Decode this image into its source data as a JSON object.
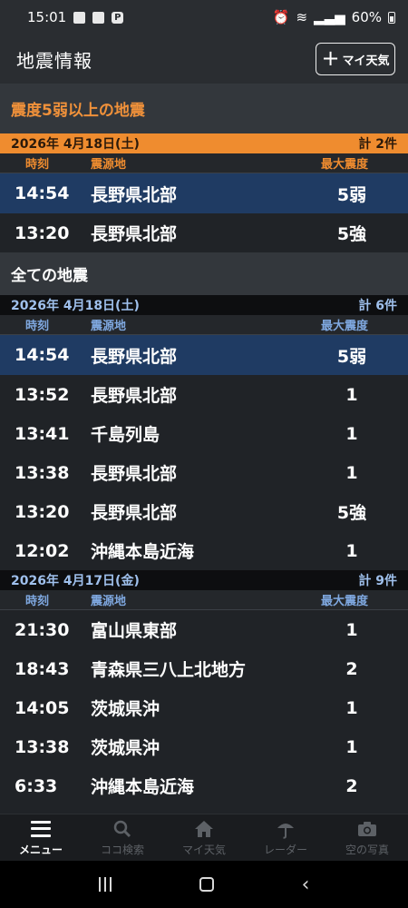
{
  "status": {
    "time": "15:01",
    "battery": "60%"
  },
  "appbar": {
    "title": "地震情報",
    "mytenki_label": "マイ天気"
  },
  "strong": {
    "title": "震度5弱以上の地震",
    "date": "2026年 4月18日(土)",
    "count": "計 2件",
    "headers": {
      "time": "時刻",
      "place": "震源地",
      "intensity": "最大震度"
    },
    "rows": [
      {
        "time": "14:54",
        "place": "長野県北部",
        "intensity": "5弱"
      },
      {
        "time": "13:20",
        "place": "長野県北部",
        "intensity": "5強"
      }
    ]
  },
  "all": {
    "title": "全ての地震",
    "groups": [
      {
        "date": "2026年 4月18日(土)",
        "count": "計 6件",
        "headers": {
          "time": "時刻",
          "place": "震源地",
          "intensity": "最大震度"
        },
        "rows": [
          {
            "time": "14:54",
            "place": "長野県北部",
            "intensity": "5弱"
          },
          {
            "time": "13:52",
            "place": "長野県北部",
            "intensity": "1"
          },
          {
            "time": "13:41",
            "place": "千島列島",
            "intensity": "1"
          },
          {
            "time": "13:38",
            "place": "長野県北部",
            "intensity": "1"
          },
          {
            "time": "13:20",
            "place": "長野県北部",
            "intensity": "5強"
          },
          {
            "time": "12:02",
            "place": "沖縄本島近海",
            "intensity": "1"
          }
        ]
      },
      {
        "date": "2026年 4月17日(金)",
        "count": "計 9件",
        "headers": {
          "time": "時刻",
          "place": "震源地",
          "intensity": "最大震度"
        },
        "rows": [
          {
            "time": "21:30",
            "place": "富山県東部",
            "intensity": "1"
          },
          {
            "time": "18:43",
            "place": "青森県三八上北地方",
            "intensity": "2"
          },
          {
            "time": "14:05",
            "place": "茨城県沖",
            "intensity": "1"
          },
          {
            "time": "13:38",
            "place": "茨城県沖",
            "intensity": "1"
          },
          {
            "time": "6:33",
            "place": "沖縄本島近海",
            "intensity": "2"
          }
        ]
      }
    ]
  },
  "bottomnav": {
    "menu": "メニュー",
    "search": "ココ検索",
    "mytenki": "マイ天気",
    "radar": "レーダー",
    "photo": "空の写真"
  },
  "colors": {
    "accent_orange": "#ef8c2f",
    "highlight_blue": "#1f3b63",
    "header_blue": "#7fa8e0"
  }
}
